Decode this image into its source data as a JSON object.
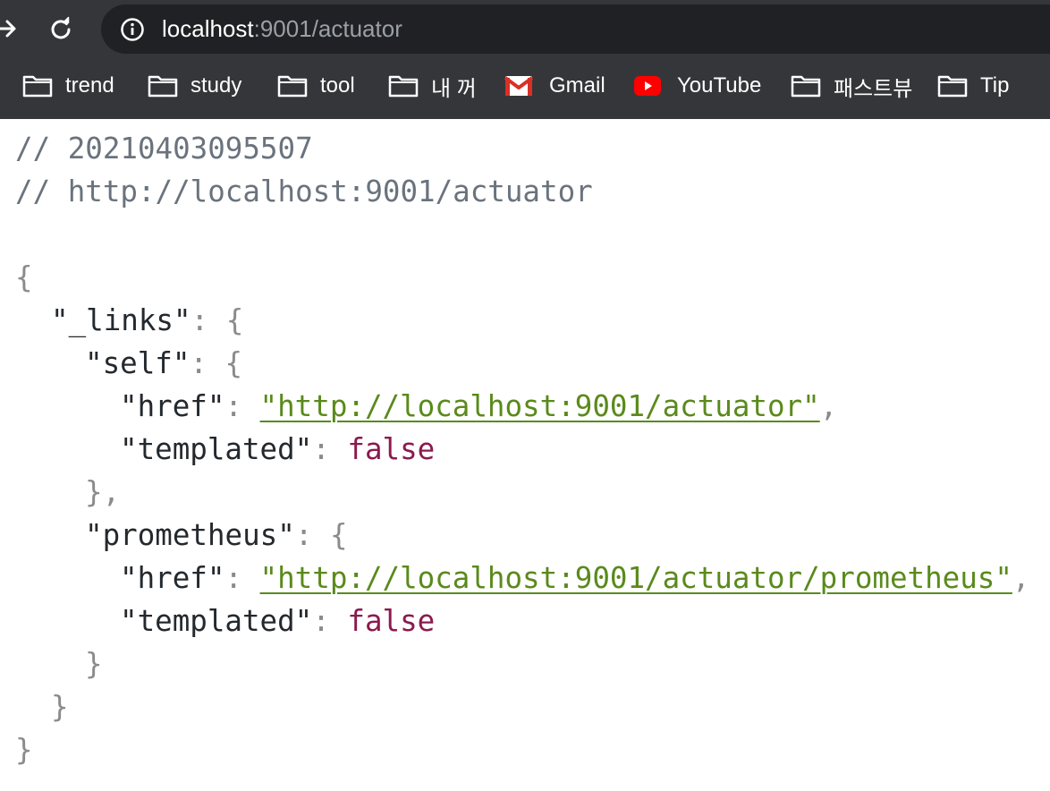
{
  "browser": {
    "url_host": "localhost",
    "url_rest": ":9001/actuator",
    "bookmarks": [
      {
        "label": "trend",
        "icon": "folder-icon"
      },
      {
        "label": "study",
        "icon": "folder-icon"
      },
      {
        "label": "tool",
        "icon": "folder-icon"
      },
      {
        "label": "내 꺼",
        "icon": "folder-icon"
      },
      {
        "label": "Gmail",
        "icon": "gmail-icon"
      },
      {
        "label": "YouTube",
        "icon": "youtube-icon"
      },
      {
        "label": "패스트뷰",
        "icon": "folder-icon"
      },
      {
        "label": "Tip",
        "icon": "folder-icon"
      }
    ]
  },
  "json_view": {
    "comment_timestamp": "// 20210403095507",
    "comment_url": "// http://localhost:9001/actuator",
    "open_brace": "{",
    "close_brace": "}",
    "links_key": "\"_links\"",
    "colon": ": ",
    "comma": ",",
    "obj_open": "{",
    "obj_close": "}",
    "obj_close_comma": "},",
    "self_key": "\"self\"",
    "prometheus_key": "\"prometheus\"",
    "href_key": "\"href\"",
    "templated_key": "\"templated\"",
    "self_href": "\"http://localhost:9001/actuator\"",
    "prometheus_href": "\"http://localhost:9001/actuator/prometheus\"",
    "self_templated": "false",
    "prometheus_templated": "false"
  },
  "colors": {
    "chrome_bg": "#35363a",
    "omnibox_bg": "#202124",
    "link": "#5a8a1c",
    "boolean": "#8b1a4e",
    "comment": "#6a737d"
  }
}
